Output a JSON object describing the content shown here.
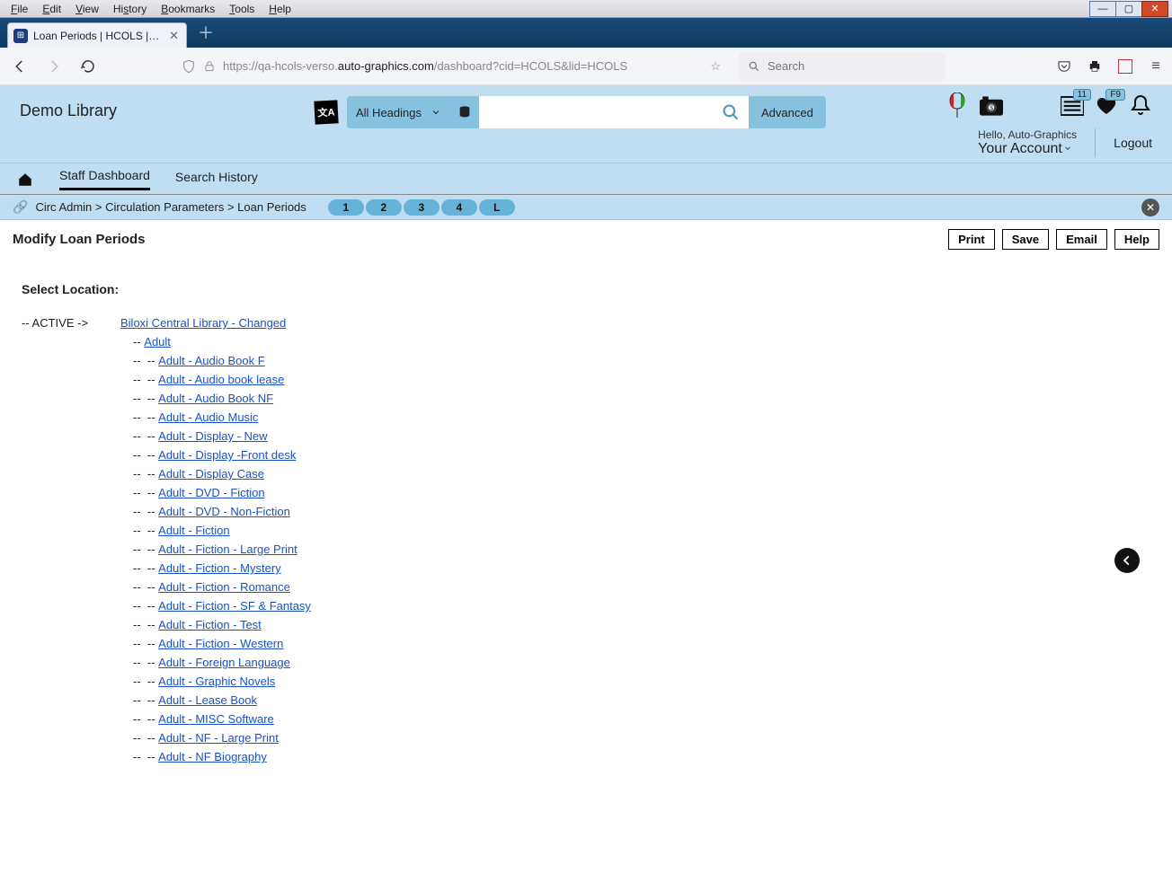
{
  "menubar": {
    "items": [
      "File",
      "Edit",
      "View",
      "History",
      "Bookmarks",
      "Tools",
      "Help"
    ]
  },
  "tab": {
    "title": "Loan Periods | HCOLS | hcols | A"
  },
  "url": {
    "prefix": "https://qa-hcols-verso.",
    "domain": "auto-graphics.com",
    "suffix": "/dashboard?cid=HCOLS&lid=HCOLS"
  },
  "browser_search": {
    "placeholder": "Search"
  },
  "library": {
    "name": "Demo Library"
  },
  "headings_select": {
    "label": "All Headings"
  },
  "advanced": {
    "label": "Advanced"
  },
  "badges": {
    "list": "11",
    "heart": "F9"
  },
  "account": {
    "hello": "Hello, Auto-Graphics",
    "label": "Your Account",
    "logout": "Logout"
  },
  "nav2": {
    "staff": "Staff Dashboard",
    "history": "Search History"
  },
  "breadcrumb": {
    "a": "Circ Admin",
    "b": "Circulation Parameters",
    "c": "Loan Periods"
  },
  "pages": [
    "1",
    "2",
    "3",
    "4",
    "L"
  ],
  "main": {
    "title": "Modify Loan Periods"
  },
  "buttons": {
    "print": "Print",
    "save": "Save",
    "email": "Email",
    "help": "Help"
  },
  "sel_location": {
    "label": "Select Location:"
  },
  "tree": {
    "status": "-- ACTIVE ->",
    "root": "Biloxi Central Library - Changed",
    "level1": "Adult",
    "items": [
      "Adult - Audio Book F",
      "Adult - Audio book lease",
      "Adult - Audio Book NF",
      "Adult - Audio Music",
      "Adult - Display - New",
      "Adult - Display -Front desk",
      "Adult - Display Case",
      "Adult - DVD - Fiction",
      "Adult - DVD - Non-Fiction",
      "Adult - Fiction",
      "Adult - Fiction - Large Print",
      "Adult - Fiction - Mystery",
      "Adult - Fiction - Romance",
      "Adult - Fiction - SF & Fantasy",
      "Adult - Fiction - Test",
      "Adult - Fiction - Western",
      "Adult - Foreign Language",
      "Adult - Graphic Novels",
      "Adult - Lease Book",
      "Adult - MISC Software",
      "Adult - NF - Large Print",
      "Adult - NF Biography"
    ]
  }
}
